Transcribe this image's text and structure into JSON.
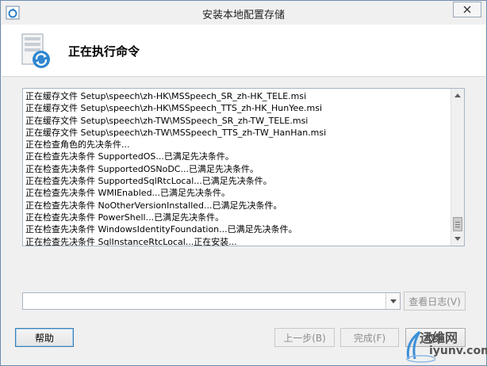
{
  "window": {
    "title": "安装本地配置存储"
  },
  "header": {
    "title": "正在执行命令"
  },
  "log": {
    "lines": [
      "正在缓存文件 Setup\\speech\\zh-HK\\MSSpeech_SR_zh-HK_TELE.msi",
      "正在缓存文件 Setup\\speech\\zh-HK\\MSSpeech_TTS_zh-HK_HunYee.msi",
      "正在缓存文件 Setup\\speech\\zh-TW\\MSSpeech_SR_zh-TW_TELE.msi",
      "正在缓存文件 Setup\\speech\\zh-TW\\MSSpeech_TTS_zh-TW_HanHan.msi",
      "正在检查角色的先决条件...",
      "正在检查先决条件 SupportedOS...已满足先决条件。",
      "正在检查先决条件 SupportedOSNoDC...已满足先决条件。",
      "正在检查先决条件 SupportedSqlRtcLocal...已满足先决条件。",
      "正在检查先决条件 WMIEnabled...已满足先决条件。",
      "正在检查先决条件 NoOtherVersionInstalled...已满足先决条件。",
      "正在检查先决条件 PowerShell...已满足先决条件。",
      "正在检查先决条件 WindowsIdentityFoundation...已满足先决条件。",
      "正在检查先决条件 SqlInstanceRtcLocal...正在安装..."
    ]
  },
  "dropdown": {
    "value": ""
  },
  "buttons": {
    "view_log": "查看日志(V)",
    "help": "帮助",
    "back": "上一步(B)",
    "finish": "完成(F)",
    "cancel": "取消"
  },
  "watermark": {
    "brand": "运维网",
    "url": "iyunv.com"
  }
}
